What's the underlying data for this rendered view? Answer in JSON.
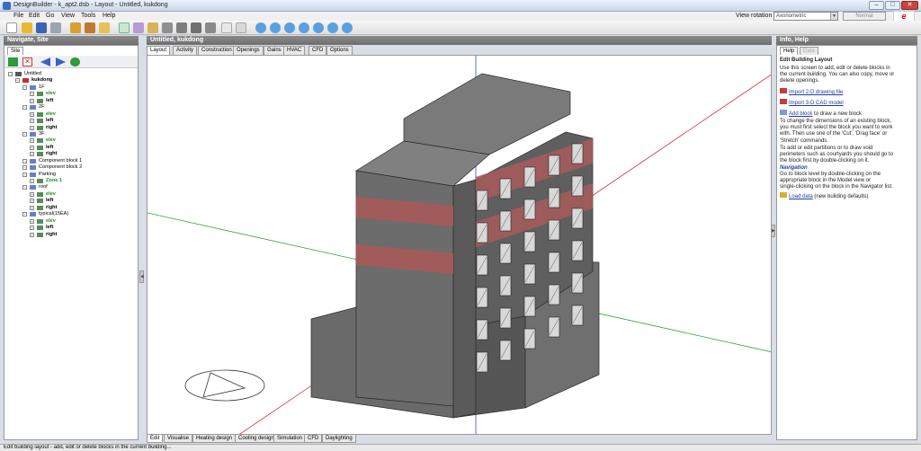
{
  "window": {
    "title": "DesignBuilder - k_apt2.dsb - Layout - Untitled, kukdong"
  },
  "menu": [
    "File",
    "Edit",
    "Go",
    "View",
    "Tools",
    "Help"
  ],
  "view_rotation": {
    "label": "View rotation",
    "value": "Axonometric",
    "normal": "Normal"
  },
  "navigate": {
    "header": "Navigate, Site",
    "tab": "Site",
    "tree": [
      {
        "label": "Untitled",
        "level": 0,
        "style": "plain"
      },
      {
        "label": "kukdong",
        "level": 1,
        "style": "bold"
      },
      {
        "label": "1F",
        "level": 2,
        "style": "plain"
      },
      {
        "label": "elev",
        "level": 3,
        "style": "green"
      },
      {
        "label": "left",
        "level": 3,
        "style": "bold"
      },
      {
        "label": "2F",
        "level": 2,
        "style": "plain"
      },
      {
        "label": "elev",
        "level": 3,
        "style": "green"
      },
      {
        "label": "left",
        "level": 3,
        "style": "bold"
      },
      {
        "label": "right",
        "level": 3,
        "style": "bold"
      },
      {
        "label": "3F",
        "level": 2,
        "style": "plain"
      },
      {
        "label": "elev",
        "level": 3,
        "style": "green"
      },
      {
        "label": "left",
        "level": 3,
        "style": "bold"
      },
      {
        "label": "right",
        "level": 3,
        "style": "bold"
      },
      {
        "label": "Component block 1",
        "level": 2,
        "style": "plain"
      },
      {
        "label": "Component block 2",
        "level": 2,
        "style": "plain"
      },
      {
        "label": "Parking",
        "level": 2,
        "style": "plain"
      },
      {
        "label": "Zone 1",
        "level": 3,
        "style": "green"
      },
      {
        "label": "roof",
        "level": 2,
        "style": "plain"
      },
      {
        "label": "elev",
        "level": 3,
        "style": "green"
      },
      {
        "label": "left",
        "level": 3,
        "style": "bold"
      },
      {
        "label": "right",
        "level": 3,
        "style": "bold"
      },
      {
        "label": "typical(15EA)",
        "level": 2,
        "style": "plain"
      },
      {
        "label": "elev",
        "level": 3,
        "style": "green"
      },
      {
        "label": "left",
        "level": 3,
        "style": "bold"
      },
      {
        "label": "right",
        "level": 3,
        "style": "bold"
      }
    ]
  },
  "main": {
    "header": "Untitled, kukdong",
    "tabs": [
      "Layout",
      "Activity",
      "Construction",
      "Openings",
      "Gains",
      "HVAC",
      "CFD",
      "Options"
    ],
    "bottom_tabs": [
      "Edit",
      "Visualise",
      "Heating design",
      "Cooling design",
      "Simulation",
      "CFD",
      "Daylighting"
    ]
  },
  "info": {
    "header": "Info, Help",
    "tabs": [
      "Help",
      "Data"
    ],
    "title": "Edit Building Layout",
    "intro": [
      "Use this screen to add, edit or delete blocks in",
      "the current building. You can also copy, move or",
      "delete openings."
    ],
    "link_import2d": "Import 2-D drawing file",
    "link_import3d": "Import 3-D CAD model",
    "link_addblock": "Add block",
    "addblock_suffix": "to draw a new block",
    "change_text": [
      "To change the dimensions of an existing block,",
      "you must first select the block you want to work",
      "with. Then use one of the 'Cut', 'Drag face' or",
      "'Stretch' commands."
    ],
    "partition_text": [
      "To add or edit partitions or to draw void",
      "perimeters such as courtyards you should go to",
      "the block first by double-clicking on it."
    ],
    "nav_title": "Navigation",
    "nav_text": [
      "Go to block level by double-clicking on the",
      "appropriate block in the Model view or",
      "single-clicking on the block in the Navigator list."
    ],
    "link_loaddata": "Load data",
    "loaddata_suffix": "(new building defaults)"
  },
  "status": "Edit building layout - add, edit or delete blocks in the current building..."
}
